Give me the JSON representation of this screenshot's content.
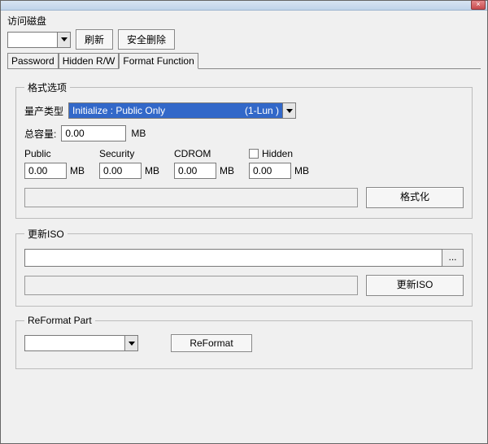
{
  "titlebar": {
    "close": "×"
  },
  "top": {
    "disk_label": "访问磁盘",
    "disk_value": "",
    "refresh": "刷新",
    "safe_delete": "安全删除"
  },
  "tabs": {
    "password": "Password",
    "hidden_rw": "Hidden R/W",
    "format_function": "Format Function"
  },
  "format_options": {
    "legend": "格式选项",
    "type_label": "量产类型",
    "type_value_left": "Initialize : Public Only",
    "type_value_right": "(1-Lun  )",
    "total_label": "总容量:",
    "total_value": "0.00",
    "mb": "MB",
    "cols": {
      "public": "Public",
      "security": "Security",
      "cdrom": "CDROM",
      "hidden": "Hidden"
    },
    "vals": {
      "public": "0.00",
      "security": "0.00",
      "cdrom": "0.00",
      "hidden": "0.00"
    },
    "format_btn": "格式化"
  },
  "update_iso": {
    "legend": "更新ISO",
    "path": "",
    "browse": "...",
    "button": "更新ISO"
  },
  "reformat": {
    "legend": "ReFormat Part",
    "value": "",
    "button": "ReFormat"
  }
}
